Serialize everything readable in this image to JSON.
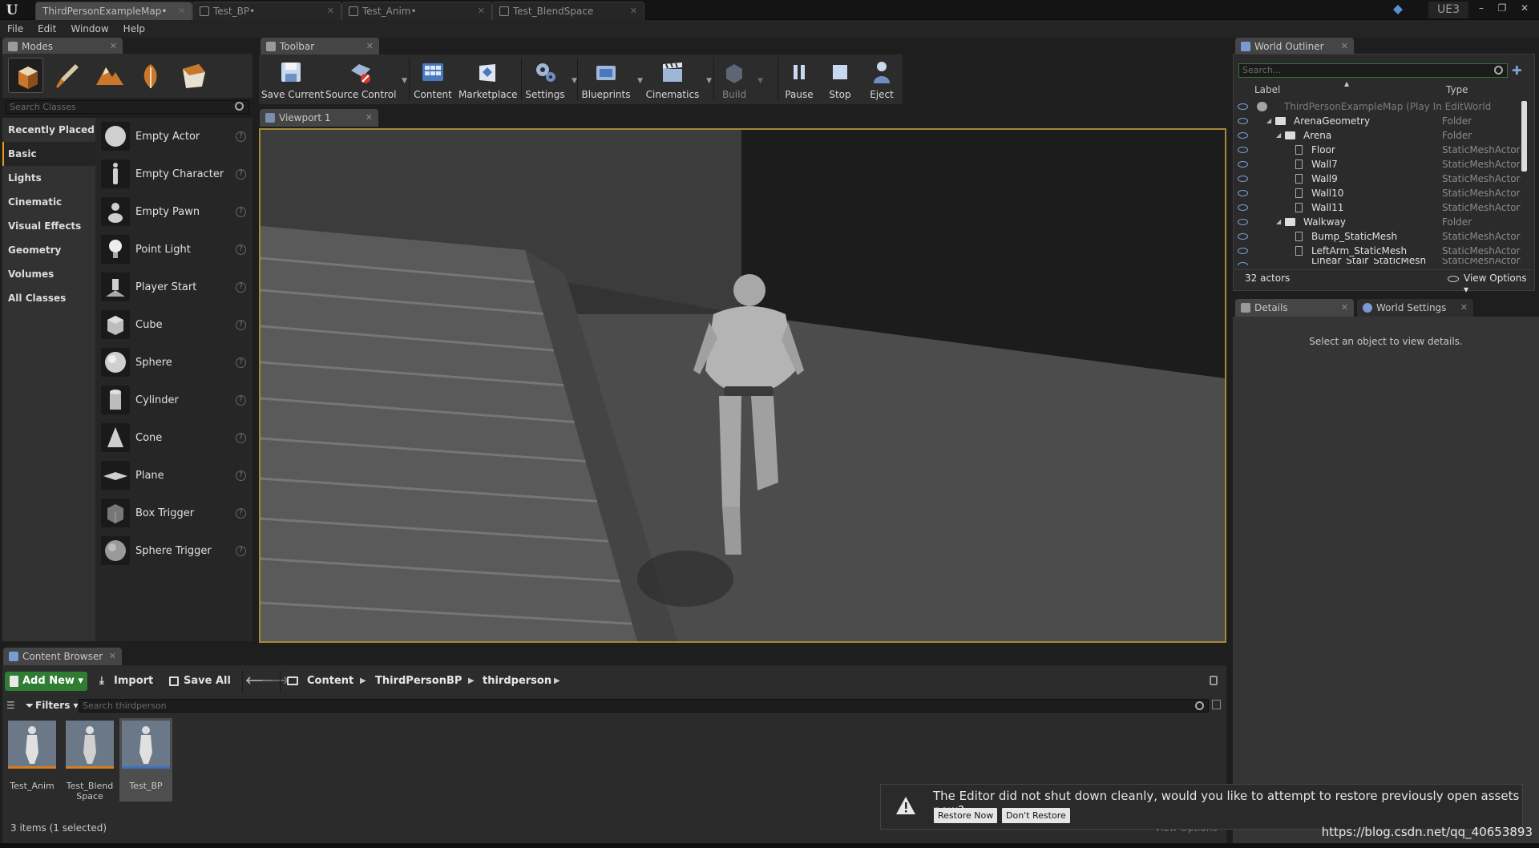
{
  "title_bar": {
    "tabs": [
      {
        "label": "ThirdPersonExampleMap•",
        "active": true
      },
      {
        "label": "Test_BP•",
        "active": false
      },
      {
        "label": "Test_Anim•",
        "active": false
      },
      {
        "label": "Test_BlendSpace",
        "active": false
      }
    ],
    "project_label": "UE3",
    "window_controls": {
      "minimize": "–",
      "maximize": "❐",
      "close": "✕"
    }
  },
  "menu": [
    "File",
    "Edit",
    "Window",
    "Help"
  ],
  "modes": {
    "tab_label": "Modes",
    "search_placeholder": "Search Classes",
    "categories": [
      "Recently Placed",
      "Basic",
      "Lights",
      "Cinematic",
      "Visual Effects",
      "Geometry",
      "Volumes",
      "All Classes"
    ],
    "active_category": "Basic",
    "items": [
      "Empty Actor",
      "Empty Character",
      "Empty Pawn",
      "Point Light",
      "Player Start",
      "Cube",
      "Sphere",
      "Cylinder",
      "Cone",
      "Plane",
      "Box Trigger",
      "Sphere Trigger"
    ],
    "help_glyph": "?"
  },
  "toolbar": {
    "tab_label": "Toolbar",
    "buttons": {
      "save_current": "Save Current",
      "source_control": "Source Control",
      "content": "Content",
      "marketplace": "Marketplace",
      "settings": "Settings",
      "blueprints": "Blueprints",
      "cinematics": "Cinematics",
      "build": "Build",
      "pause": "Pause",
      "stop": "Stop",
      "eject": "Eject"
    }
  },
  "viewport": {
    "tab_label": "Viewport 1"
  },
  "world_outliner": {
    "tab_label": "World Outliner",
    "search_placeholder": "Search...",
    "col_label": "Label",
    "col_type": "Type",
    "rows": [
      {
        "name": "ThirdPersonExampleMap (Play In EditWorld",
        "type": "",
        "depth": 0,
        "kind": "world"
      },
      {
        "name": "ArenaGeometry",
        "type": "Folder",
        "depth": 1,
        "kind": "folder"
      },
      {
        "name": "Arena",
        "type": "Folder",
        "depth": 2,
        "kind": "folder"
      },
      {
        "name": "Floor",
        "type": "StaticMeshActor",
        "depth": 3,
        "kind": "actor"
      },
      {
        "name": "Wall7",
        "type": "StaticMeshActor",
        "depth": 3,
        "kind": "actor"
      },
      {
        "name": "Wall9",
        "type": "StaticMeshActor",
        "depth": 3,
        "kind": "actor"
      },
      {
        "name": "Wall10",
        "type": "StaticMeshActor",
        "depth": 3,
        "kind": "actor"
      },
      {
        "name": "Wall11",
        "type": "StaticMeshActor",
        "depth": 3,
        "kind": "actor"
      },
      {
        "name": "Walkway",
        "type": "Folder",
        "depth": 2,
        "kind": "folder"
      },
      {
        "name": "Bump_StaticMesh",
        "type": "StaticMeshActor",
        "depth": 3,
        "kind": "actor"
      },
      {
        "name": "LeftArm_StaticMesh",
        "type": "StaticMeshActor",
        "depth": 3,
        "kind": "actor"
      },
      {
        "name": "Linear_Stair_StaticMesh",
        "type": "StaticMeshActor",
        "depth": 3,
        "kind": "actor"
      }
    ],
    "actor_count": "32 actors",
    "view_options": "View Options"
  },
  "details": {
    "tab_label": "Details",
    "world_settings_tab": "World Settings",
    "empty_message": "Select an object to view details."
  },
  "content_browser": {
    "tab_label": "Content Browser",
    "add_new": "Add New",
    "import": "Import",
    "save_all": "Save All",
    "path": [
      "Content",
      "ThirdPersonBP",
      "thirdperson"
    ],
    "filters": "Filters",
    "search_placeholder": "Search thirdperson",
    "assets": [
      {
        "label": "Test_Anim",
        "selected": false
      },
      {
        "label": "Test_Blend Space",
        "selected": false
      },
      {
        "label": "Test_BP",
        "selected": true
      }
    ],
    "status": "3 items (1 selected)",
    "view_options": "View Options"
  },
  "notification": {
    "message": "The Editor did not shut down cleanly, would you like to attempt to restore previously open assets now?",
    "restore_now": "Restore Now",
    "dont_restore": "Don't Restore"
  },
  "watermark": "https://blog.csdn.net/qq_40653893",
  "colors": {
    "accent_orange": "#e89b1d",
    "viewport_border": "#a68a3a",
    "add_new_green": "#2e7d32",
    "outliner_eye": "#7aa0d4"
  }
}
